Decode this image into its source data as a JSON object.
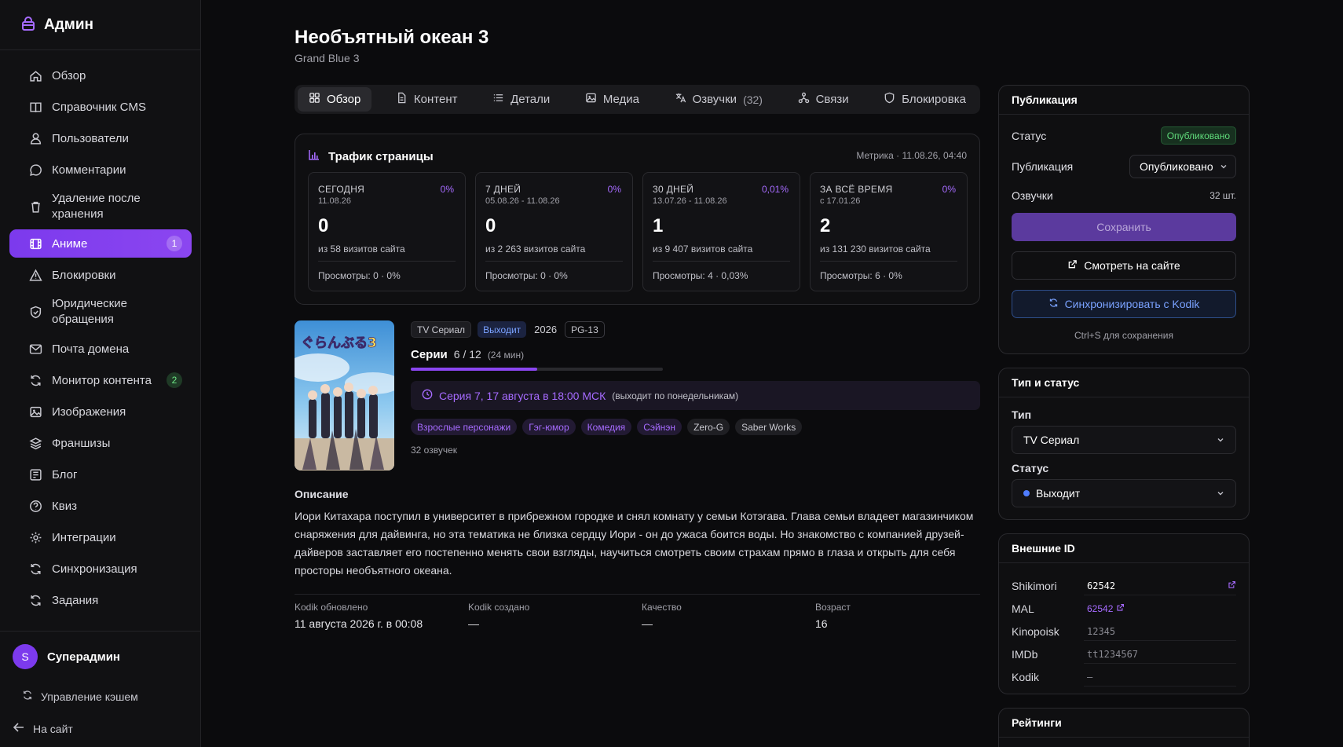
{
  "sidebar": {
    "brand": "Админ",
    "items": [
      {
        "label": "Обзор",
        "icon": "home-icon"
      },
      {
        "label": "Справочник CMS",
        "icon": "book-icon"
      },
      {
        "label": "Пользователи",
        "icon": "users-icon"
      },
      {
        "label": "Комментарии",
        "icon": "comment-icon"
      },
      {
        "label": "Удаление после хранения",
        "icon": "trash-icon"
      },
      {
        "label": "Аниме",
        "icon": "film-icon",
        "badge": "1",
        "active": true
      },
      {
        "label": "Блокировки",
        "icon": "alert-triangle-icon"
      },
      {
        "label": "Юридические обращения",
        "icon": "shield-icon"
      },
      {
        "label": "Почта домена",
        "icon": "mail-icon"
      },
      {
        "label": "Монитор контента",
        "icon": "refresh-icon",
        "badge": "2"
      },
      {
        "label": "Изображения",
        "icon": "image-icon"
      },
      {
        "label": "Франшизы",
        "icon": "layers-icon"
      },
      {
        "label": "Блог",
        "icon": "newspaper-icon"
      },
      {
        "label": "Квиз",
        "icon": "help-circle-icon"
      },
      {
        "label": "Интеграции",
        "icon": "gear-icon"
      },
      {
        "label": "Синхронизация",
        "icon": "sync-icon"
      },
      {
        "label": "Задания",
        "icon": "tasks-icon"
      }
    ],
    "user": {
      "initial": "S",
      "name": "Суперадмин"
    },
    "cache_link": "Управление кэшем",
    "back_link": "На сайт"
  },
  "header": {
    "title": "Необъятный океан 3",
    "subtitle": "Grand Blue 3"
  },
  "tabs": [
    {
      "label": "Обзор",
      "icon": "grid-icon",
      "active": true
    },
    {
      "label": "Контент",
      "icon": "file-icon"
    },
    {
      "label": "Детали",
      "icon": "list-icon"
    },
    {
      "label": "Медиа",
      "icon": "image-icon"
    },
    {
      "label": "Озвучки",
      "count": "(32)",
      "icon": "translate-icon"
    },
    {
      "label": "Связи",
      "icon": "network-icon"
    },
    {
      "label": "Блокировка",
      "icon": "block-icon"
    }
  ],
  "traffic": {
    "title": "Трафик страницы",
    "meta": "Метрика · 11.08.26, 04:40",
    "cards": [
      {
        "title": "СЕГОДНЯ",
        "pct": "0%",
        "date": "11.08.26",
        "value": "0",
        "sub": "из 58 визитов сайта",
        "views": "Просмотры: 0 · 0%"
      },
      {
        "title": "7 ДНЕЙ",
        "pct": "0%",
        "date": "05.08.26 - 11.08.26",
        "value": "0",
        "sub": "из 2 263 визитов сайта",
        "views": "Просмотры: 0 · 0%"
      },
      {
        "title": "30 ДНЕЙ",
        "pct": "0,01%",
        "date": "13.07.26 - 11.08.26",
        "value": "1",
        "sub": "из 9 407 визитов сайта",
        "views": "Просмотры: 4 · 0,03%"
      },
      {
        "title": "ЗА ВСЁ ВРЕМЯ",
        "pct": "0%",
        "date": "с 17.01.26",
        "value": "2",
        "sub": "из 131 230 визитов сайта",
        "views": "Просмотры: 6 · 0%"
      }
    ]
  },
  "anime": {
    "type_chip": "TV Сериал",
    "status_chip": "Выходит",
    "year": "2026",
    "rating": "PG-13",
    "series_label": "Серии",
    "series_value": "6 / 12",
    "series_duration": "(24 мин)",
    "progress_fraction": 0.5,
    "next_episode": "Серия 7, 17 августа в 18:00 МСК",
    "next_episode_note": "(выходит по понедельникам)",
    "genres": [
      {
        "label": "Взрослые персонажи",
        "style": "v"
      },
      {
        "label": "Гэг-юмор",
        "style": "v"
      },
      {
        "label": "Комедия",
        "style": "v"
      },
      {
        "label": "Сэйнэн",
        "style": "v"
      },
      {
        "label": "Zero-G",
        "style": "g"
      },
      {
        "label": "Saber Works",
        "style": "g"
      }
    ],
    "dubs_count": "32 озвучек",
    "poster_text": "ぐらんぶる3"
  },
  "description": {
    "title": "Описание",
    "text": "Иори Китахара поступил в университет в прибрежном городке и снял комнату у семьи Котэгава. Глава семьи владеет магазинчиком снаряжения для дайвинга, но эта тематика не близка сердцу Иори - он до ужаса боится воды. Но знакомство с компанией друзей-дайверов заставляет его постепенно менять свои взгляды, научиться смотреть своим страхам прямо в глаза и открыть для себя просторы необъятного океана."
  },
  "meta": [
    {
      "label": "Kodik обновлено",
      "value": "11 августа 2026 г. в 00:08"
    },
    {
      "label": "Kodik создано",
      "value": "—"
    },
    {
      "label": "Качество",
      "value": "—"
    },
    {
      "label": "Возраст",
      "value": "16"
    }
  ],
  "publication": {
    "title": "Публикация",
    "status_label": "Статус",
    "status_badge": "Опубликовано",
    "pub_label": "Публикация",
    "pub_select": "Опубликовано",
    "dubs_label": "Озвучки",
    "dubs_value": "32 шт.",
    "save": "Сохранить",
    "view": "Смотреть на сайте",
    "sync": "Синхронизировать с Kodik",
    "hint": "Ctrl+S для сохранения"
  },
  "type_status": {
    "title": "Тип и статус",
    "type_label": "Тип",
    "type_value": "TV Сериал",
    "status_label": "Статус",
    "status_value": "Выходит"
  },
  "external_ids": {
    "title": "Внешние ID",
    "rows": [
      {
        "label": "Shikimori",
        "value": "62542"
      },
      {
        "label": "MAL",
        "value": "62542"
      },
      {
        "label": "Kinopoisk",
        "value": "12345"
      },
      {
        "label": "IMDb",
        "value": "tt1234567"
      },
      {
        "label": "Kodik",
        "value": "—"
      }
    ]
  },
  "ratings": {
    "title": "Рейтинги"
  },
  "colors": {
    "accent": "#7c3aed",
    "link": "#a66bff",
    "success": "#5fd97a",
    "info": "#7aa2ff"
  }
}
